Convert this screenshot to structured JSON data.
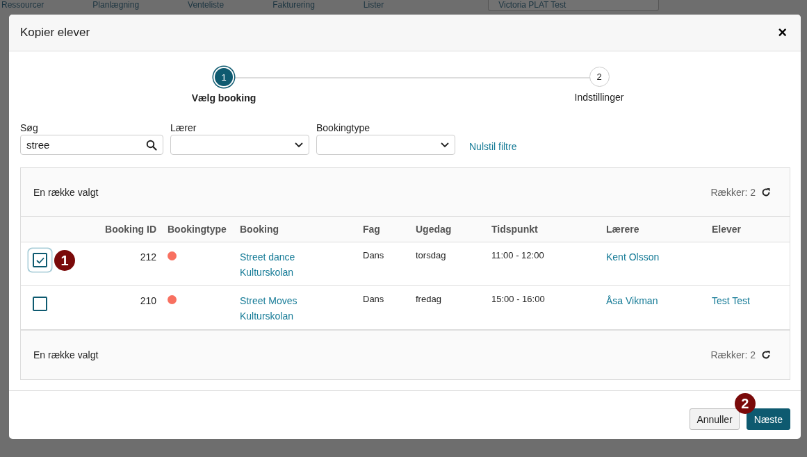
{
  "background_nav": [
    "Ressourcer",
    "Planlægning",
    "Venteliste",
    "Fakturering",
    "Lister"
  ],
  "background_select": "Victoria PLAT Test",
  "dialog": {
    "title": "Kopier elever",
    "close": "×"
  },
  "steps": [
    {
      "number": "1",
      "label": "Vælg booking",
      "selected": true
    },
    {
      "number": "2",
      "label": "Indstillinger",
      "selected": false
    }
  ],
  "filters": {
    "search": {
      "label": "Søg",
      "value": "stree"
    },
    "teacher": {
      "label": "Lærer"
    },
    "booking_type": {
      "label": "Bookingtype"
    },
    "reset": "Nulstil filtre"
  },
  "table": {
    "summary_top": "En række valgt",
    "rows_count_top": "Rækker: 2",
    "summary_bottom": "En række valgt",
    "rows_count_bottom": "Rækker: 2",
    "columns": [
      "Booking ID",
      "Bookingtype",
      "Booking",
      "Fag",
      "Ugedag",
      "Tidspunkt",
      "Lærere",
      "Elever"
    ],
    "rows": [
      {
        "checked": true,
        "marker": "1",
        "id": "212",
        "color": "#f87060",
        "booking": [
          "Street dance",
          "Kulturskolan"
        ],
        "subject": "Dans",
        "weekday": "torsdag",
        "time": "11:00 - 12:00",
        "teacher": "Kent Olsson"
      },
      {
        "checked": false,
        "id": "210",
        "color": "#f87060",
        "booking": [
          "Street Moves",
          "Kulturskolan"
        ],
        "subject": "Dans",
        "weekday": "fredag",
        "time": "15:00 - 16:00",
        "teacher": "Åsa Vikman",
        "students": "Test Test"
      }
    ]
  },
  "footer": {
    "cancel": "Annuller",
    "next": "Næste",
    "marker": "2"
  }
}
